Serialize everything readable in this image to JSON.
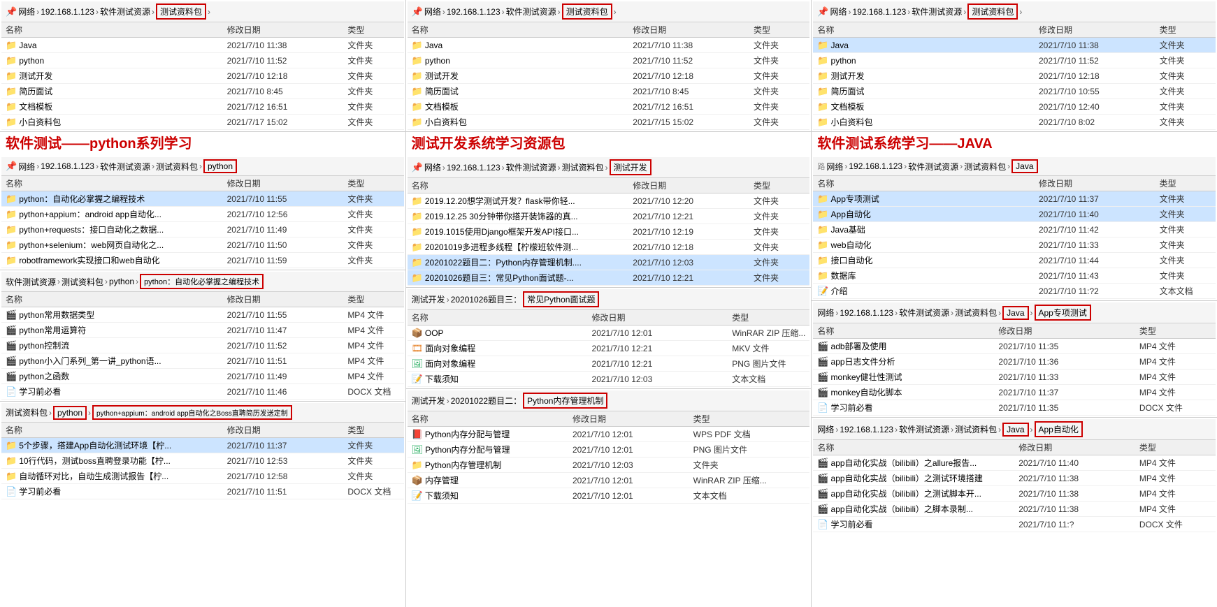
{
  "colors": {
    "accent_red": "#cc0000",
    "folder_yellow": "#f5c518",
    "selected_blue": "#cce4ff",
    "bg": "#f0f0f0"
  },
  "panels": {
    "left": {
      "top_address": [
        "网络",
        "192.168.1.123",
        "软件测试资源",
        "测试资料包"
      ],
      "top_label": "软件测试——python系列学习",
      "top_files": [
        {
          "name": "Java",
          "date": "2021/7/10 11:38",
          "type": "文件夹",
          "icon": "folder"
        },
        {
          "name": "python",
          "date": "2021/7/10 11:52",
          "type": "文件夹",
          "icon": "folder"
        },
        {
          "name": "测试开发",
          "date": "2021/7/10 12:18",
          "type": "文件夹",
          "icon": "folder"
        },
        {
          "name": "简历面试",
          "date": "2021/7/10 8:45",
          "type": "文件夹",
          "icon": "folder"
        },
        {
          "name": "文档模板",
          "date": "2021/7/12 16:51",
          "type": "文件夹",
          "icon": "folder"
        },
        {
          "name": "小白资料包",
          "date": "2021/7/17 15:02",
          "type": "文件夹",
          "icon": "folder"
        }
      ],
      "mid_address": [
        "网络",
        "192.168.1.123",
        "软件测试资源",
        "测试资料包",
        "python"
      ],
      "mid_files": [
        {
          "name": "python：自动化必掌握之编程技术",
          "date": "2021/7/10 11:55",
          "type": "文件夹",
          "icon": "folder",
          "selected": true
        },
        {
          "name": "python+appium：android app自动化...",
          "date": "2021/7/10 12:56",
          "type": "文件夹",
          "icon": "folder"
        },
        {
          "name": "python+requests：接口自动化之数据...",
          "date": "2021/7/10 11:49",
          "type": "文件夹",
          "icon": "folder"
        },
        {
          "name": "python+selenium：web网页自动化之...",
          "date": "2021/7/10 11:50",
          "type": "文件夹",
          "icon": "folder"
        },
        {
          "name": "robotframework实现接口和web自动化",
          "date": "2021/7/10 11:59",
          "type": "文件夹",
          "icon": "folder"
        }
      ],
      "bot_address1": [
        "软件测试资源",
        "测试资料包",
        "python",
        "python：自动化必掌握之编程技术"
      ],
      "bot_files1": [
        {
          "name": "python常用数据类型",
          "date": "2021/7/10 11:55",
          "type": "MP4 文件",
          "icon": "mp4"
        },
        {
          "name": "python常用运算符",
          "date": "2021/7/10 11:47",
          "type": "MP4 文件",
          "icon": "mp4"
        },
        {
          "name": "python控制流",
          "date": "2021/7/10 11:52",
          "type": "MP4 文件",
          "icon": "mp4"
        },
        {
          "name": "python小入门系列_第一讲_python语...",
          "date": "2021/7/10 11:51",
          "type": "MP4 文件",
          "icon": "mp4"
        },
        {
          "name": "python之函数",
          "date": "2021/7/10 11:49",
          "type": "MP4 文件",
          "icon": "mp4"
        },
        {
          "name": "学习前必看",
          "date": "2021/7/10 11:46",
          "type": "DOCX 文档",
          "icon": "doc"
        }
      ],
      "bot_address2_segs": [
        "测试资料包",
        "python",
        "python+appium：android app自动化之Boss直聘简历发送定制"
      ],
      "bot_files2": [
        {
          "name": "5个步骤，搭建App自动化测试环境【柠...",
          "date": "2021/7/10 11:37",
          "type": "文件夹",
          "icon": "folder",
          "selected": true
        },
        {
          "name": "10行代码，测试boss直聘登录功能【柠...",
          "date": "2021/7/10 12:53",
          "type": "文件夹",
          "icon": "folder"
        },
        {
          "name": "自动循环对比，自动生成测试报告【柠...",
          "date": "2021/7/10 12:58",
          "type": "文件夹",
          "icon": "folder"
        },
        {
          "name": "学习前必看",
          "date": "2021/7/10 11:51",
          "type": "DOCX 文档",
          "icon": "doc"
        }
      ]
    },
    "middle": {
      "top_address": [
        "网络",
        "192.168.1.123",
        "软件测试资源",
        "测试资料包"
      ],
      "top_label": "测试开发系统学习资源包",
      "top_files": [
        {
          "name": "Java",
          "date": "2021/7/10 11:38",
          "type": "文件夹",
          "icon": "folder"
        },
        {
          "name": "python",
          "date": "2021/7/10 11:52",
          "type": "文件夹",
          "icon": "folder"
        },
        {
          "name": "测试开发",
          "date": "2021/7/10 12:18",
          "type": "文件夹",
          "icon": "folder"
        },
        {
          "name": "简历面试",
          "date": "2021/7/10 8:45",
          "type": "文件夹",
          "icon": "folder"
        },
        {
          "name": "文档模板",
          "date": "2021/7/12 16:51",
          "type": "文件夹",
          "icon": "folder"
        },
        {
          "name": "小白资料包",
          "date": "2021/7/15 15:02",
          "type": "文件夹",
          "icon": "folder"
        }
      ],
      "mid_address": [
        "网络",
        "192.168.1.123",
        "软件测试资源",
        "测试资料包",
        "测试开发"
      ],
      "mid_files": [
        {
          "name": "2019.12.20想学测试开发？flask带你轻...",
          "date": "2021/7/10 12:20",
          "type": "文件夹",
          "icon": "folder"
        },
        {
          "name": "2019.12.25 30分钟带你搭开装饰器的真...",
          "date": "2021/7/10 12:21",
          "type": "文件夹",
          "icon": "folder"
        },
        {
          "name": "2019.1015使用Django框架开发API接口...",
          "date": "2021/7/10 12:19",
          "type": "文件夹",
          "icon": "folder"
        },
        {
          "name": "20201019多进程多线程【柠檬班软件测...",
          "date": "2021/7/10 12:18",
          "type": "文件夹",
          "icon": "folder"
        },
        {
          "name": "20201022题目二：Python内存管理机制....",
          "date": "2021/7/10 12:03",
          "type": "文件夹",
          "icon": "folder",
          "selected": true
        },
        {
          "name": "20201026题目三：常见Python面试题-...",
          "date": "2021/7/10 12:21",
          "type": "文件夹",
          "icon": "folder",
          "selected": true
        }
      ],
      "bot_address1_segs": [
        "测试开发",
        "20201026题目三：常见Python面试题"
      ],
      "bot_files1": [
        {
          "name": "OOP",
          "date": "2021/7/10 12:01",
          "type": "WinRAR ZIP 压缩...",
          "icon": "zip"
        },
        {
          "name": "面向对象编程",
          "date": "2021/7/10 12:21",
          "type": "MKV 文件",
          "icon": "mkv"
        },
        {
          "name": "面向对象编程",
          "date": "2021/7/10 12:21",
          "type": "PNG 图片文件",
          "icon": "png"
        },
        {
          "name": "下载须知",
          "date": "2021/7/10 12:03",
          "type": "文本文档",
          "icon": "txt"
        }
      ],
      "bot_address2_segs": [
        "测试开发",
        "20201022题目二：Python内存管理机制"
      ],
      "bot_files2": [
        {
          "name": "Python内存分配与管理",
          "date": "2021/7/10 12:01",
          "type": "WPS PDF 文档",
          "icon": "pdf"
        },
        {
          "name": "Python内存分配与管理",
          "date": "2021/7/10 12:01",
          "type": "PNG 图片文件",
          "icon": "png"
        },
        {
          "name": "Python内存管理机制",
          "date": "2021/7/10 12:03",
          "type": "文件夹",
          "icon": "folder"
        },
        {
          "name": "内存管理",
          "date": "2021/7/10 12:01",
          "type": "WinRAR ZIP 压缩...",
          "icon": "zip"
        },
        {
          "name": "下载须知",
          "date": "2021/7/10 12:01",
          "type": "文本文档",
          "icon": "txt"
        }
      ]
    },
    "right": {
      "top_address": [
        "网络",
        "192.168.1.123",
        "软件测试资源",
        "测试资料包"
      ],
      "top_label": "软件测试系统学习——JAVA",
      "top_files": [
        {
          "name": "Java",
          "date": "2021/7/10 11:38",
          "type": "文件夹",
          "icon": "folder",
          "selected": true
        },
        {
          "name": "python",
          "date": "2021/7/10 11:52",
          "type": "文件夹",
          "icon": "folder"
        },
        {
          "name": "测试开发",
          "date": "2021/7/10 12:18",
          "type": "文件夹",
          "icon": "folder"
        },
        {
          "name": "简历面试",
          "date": "2021/7/10 10:55",
          "type": "文件夹",
          "icon": "folder"
        },
        {
          "name": "文档模板",
          "date": "2021/7/10 12:40",
          "type": "文件夹",
          "icon": "folder"
        },
        {
          "name": "小白资料包",
          "date": "2021/7/10 8:02",
          "type": "文件夹",
          "icon": "folder"
        }
      ],
      "mid_address": [
        "网络",
        "192.168.1.123",
        "软件测试资源",
        "测试资料包",
        "Java"
      ],
      "mid_files": [
        {
          "name": "App专项测试",
          "date": "2021/7/10 11:37",
          "type": "文件夹",
          "icon": "folder",
          "selected": true
        },
        {
          "name": "App自动化",
          "date": "2021/7/10 11:40",
          "type": "文件夹",
          "icon": "folder",
          "selected": true
        },
        {
          "name": "Java基础",
          "date": "2021/7/10 11:42",
          "type": "文件夹",
          "icon": "folder"
        },
        {
          "name": "web自动化",
          "date": "2021/7/10 11:33",
          "type": "文件夹",
          "icon": "folder"
        },
        {
          "name": "接口自动化",
          "date": "2021/7/10 11:44",
          "type": "文件夹",
          "icon": "folder"
        },
        {
          "name": "数据库",
          "date": "2021/7/10 11:43",
          "type": "文件夹",
          "icon": "folder"
        },
        {
          "name": "介绍",
          "date": "2021/7/10 11:?2",
          "type": "文本文档",
          "icon": "txt"
        }
      ],
      "bot_address1_segs": [
        "网络",
        "192.168.1.123",
        "软件测试资源",
        "测试资料包",
        "Java",
        "App专项测试"
      ],
      "bot_files1": [
        {
          "name": "adb部署及使用",
          "date": "2021/7/10 11:35",
          "type": "MP4 文件",
          "icon": "mp4"
        },
        {
          "name": "app日志文件分析",
          "date": "2021/7/10 11:36",
          "type": "MP4 文件",
          "icon": "mp4"
        },
        {
          "name": "monkey健壮性测试",
          "date": "2021/7/10 11:33",
          "type": "MP4 文件",
          "icon": "mp4"
        },
        {
          "name": "monkey自动化脚本",
          "date": "2021/7/10 11:37",
          "type": "MP4 文件",
          "icon": "mp4"
        },
        {
          "name": "学习前必看",
          "date": "2021/7/10 11:35",
          "type": "DOCX 文件",
          "icon": "doc"
        }
      ],
      "bot_address2_segs": [
        "网络",
        "192.168.1.123",
        "软件测试资源",
        "测试资料包",
        "Java",
        "App自动化"
      ],
      "bot_files2": [
        {
          "name": "app自动化实战（bilibili）之allure报告...",
          "date": "2021/7/10 11:40",
          "type": "MP4 文件",
          "icon": "mp4"
        },
        {
          "name": "app自动化实战（bilibili）之测试环境搭建",
          "date": "2021/7/10 11:38",
          "type": "MP4 文件",
          "icon": "mp4"
        },
        {
          "name": "app自动化实战（bilibili）之测试脚本开...",
          "date": "2021/7/10 11:38",
          "type": "MP4 文件",
          "icon": "mp4"
        },
        {
          "name": "app自动化实战（bilibili）之脚本录制...",
          "date": "2021/7/10 11:38",
          "type": "MP4 文件",
          "icon": "mp4"
        },
        {
          "name": "学习前必看",
          "date": "2021/7/10 11:?",
          "type": "DOCX 文件",
          "icon": "doc"
        }
      ]
    }
  },
  "headers": {
    "name": "名称",
    "date": "修改日期",
    "type": "类型"
  }
}
